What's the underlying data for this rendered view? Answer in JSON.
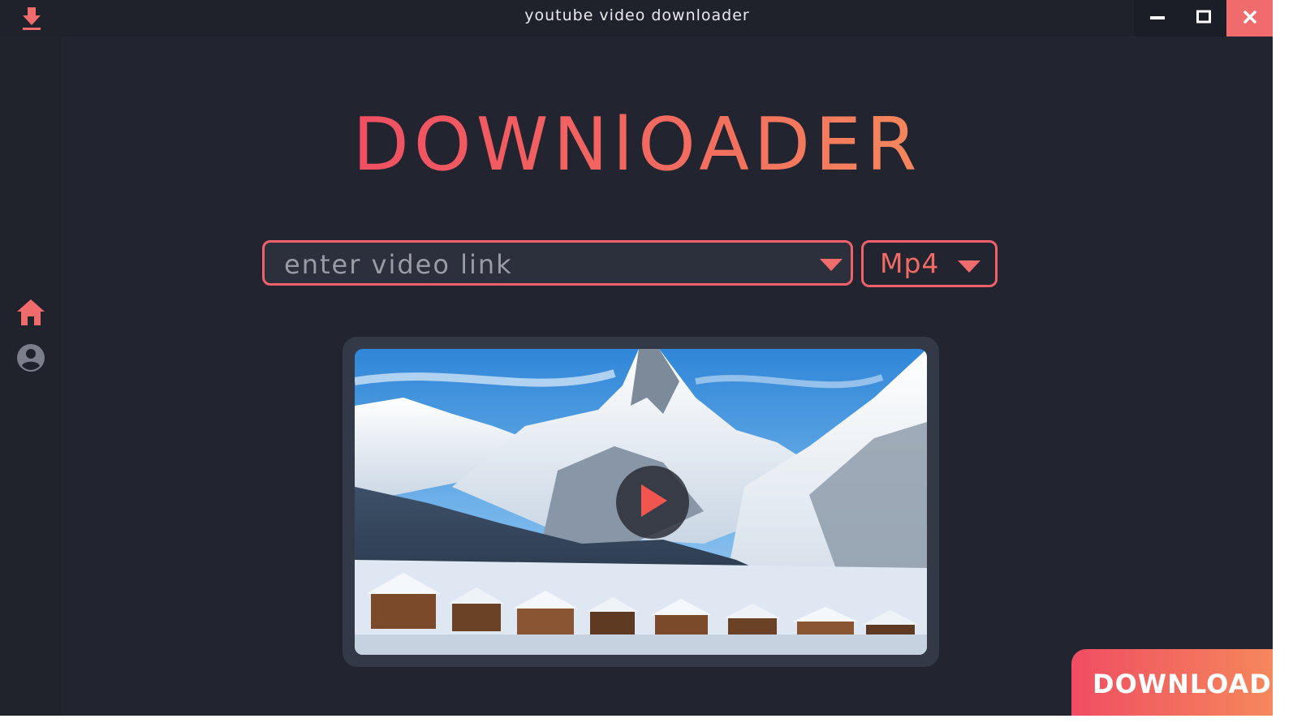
{
  "window": {
    "title": "youtube video downloader"
  },
  "header": {
    "heading": "DOWNlOADER"
  },
  "link_input": {
    "placeholder": "enter video link",
    "value": ""
  },
  "format_select": {
    "selected": "Mp4"
  },
  "actions": {
    "download_label": "DOWNLOAD"
  },
  "icons": {
    "app": "download-arrow-icon",
    "minimize": "minimize-icon",
    "maximize": "maximize-icon",
    "close": "close-icon",
    "home": "home-icon",
    "user": "user-icon",
    "play": "play-icon"
  },
  "colors": {
    "accent": "#f0616b",
    "accent_end": "#f58a5b",
    "background": "#222430",
    "panel": "#2c303d",
    "close_button": "#f06b6b"
  }
}
